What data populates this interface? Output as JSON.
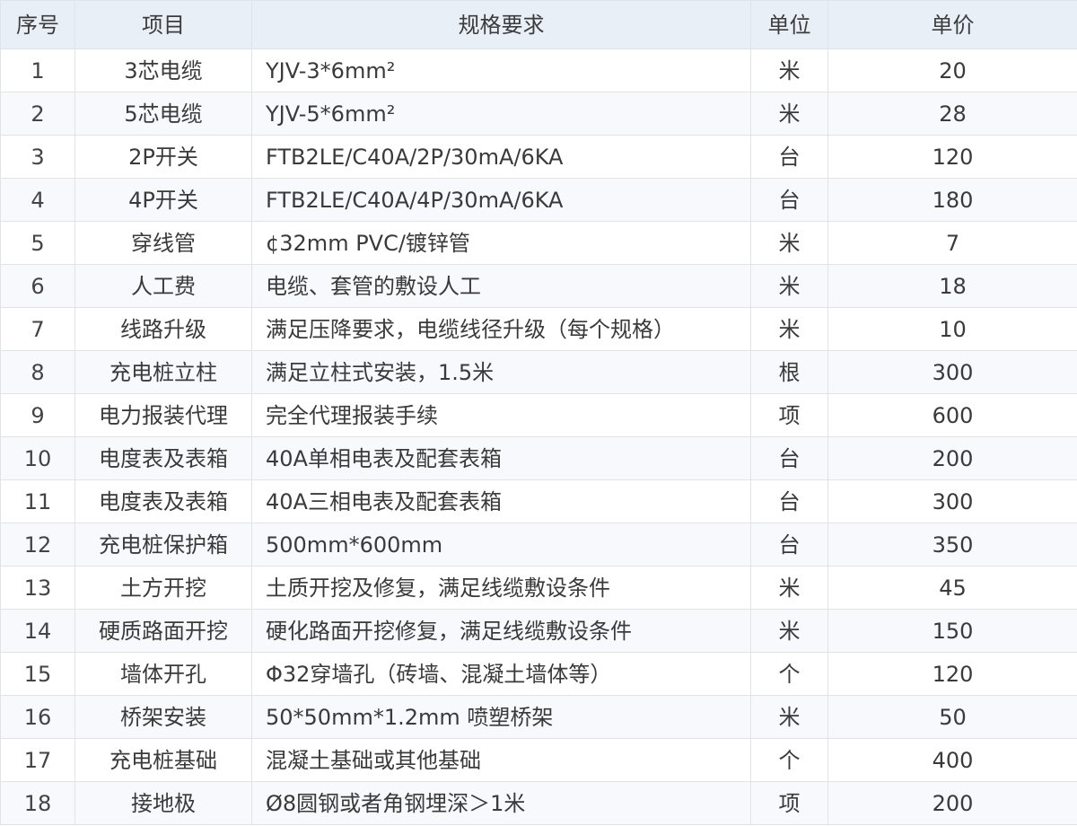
{
  "table": {
    "headers": [
      "序号",
      "项目",
      "规格要求",
      "单位",
      "单价"
    ],
    "rows": [
      {
        "index": "1",
        "item": "3芯电缆",
        "spec": "YJV-3*6mm²",
        "unit": "米",
        "price": "20"
      },
      {
        "index": "2",
        "item": "5芯电缆",
        "spec": "YJV-5*6mm²",
        "unit": "米",
        "price": "28"
      },
      {
        "index": "3",
        "item": "2P开关",
        "spec": "FTB2LE/C40A/2P/30mA/6KA",
        "unit": "台",
        "price": "120"
      },
      {
        "index": "4",
        "item": "4P开关",
        "spec": "FTB2LE/C40A/4P/30mA/6KA",
        "unit": "台",
        "price": "180"
      },
      {
        "index": "5",
        "item": "穿线管",
        "spec": "¢32mm PVC/镀锌管",
        "unit": "米",
        "price": "7"
      },
      {
        "index": "6",
        "item": "人工费",
        "spec": "电缆、套管的敷设人工",
        "unit": "米",
        "price": "18"
      },
      {
        "index": "7",
        "item": "线路升级",
        "spec": "满足压降要求，电缆线径升级（每个规格）",
        "unit": "米",
        "price": "10"
      },
      {
        "index": "8",
        "item": "充电桩立柱",
        "spec": "满足立柱式安装，1.5米",
        "unit": "根",
        "price": "300"
      },
      {
        "index": "9",
        "item": "电力报装代理",
        "spec": "完全代理报装手续",
        "unit": "项",
        "price": "600"
      },
      {
        "index": "10",
        "item": "电度表及表箱",
        "spec": "40A单相电表及配套表箱",
        "unit": "台",
        "price": "200"
      },
      {
        "index": "11",
        "item": "电度表及表箱",
        "spec": "40A三相电表及配套表箱",
        "unit": "台",
        "price": "300"
      },
      {
        "index": "12",
        "item": "充电桩保护箱",
        "spec": "500mm*600mm",
        "unit": "台",
        "price": "350"
      },
      {
        "index": "13",
        "item": "土方开挖",
        "spec": "土质开挖及修复，满足线缆敷设条件",
        "unit": "米",
        "price": "45"
      },
      {
        "index": "14",
        "item": "硬质路面开挖",
        "spec": "硬化路面开挖修复，满足线缆敷设条件",
        "unit": "米",
        "price": "150"
      },
      {
        "index": "15",
        "item": "墙体开孔",
        "spec": "Φ32穿墙孔（砖墙、混凝土墙体等）",
        "unit": "个",
        "price": "120"
      },
      {
        "index": "16",
        "item": "桥架安装",
        "spec": "50*50mm*1.2mm 喷塑桥架",
        "unit": "米",
        "price": "50"
      },
      {
        "index": "17",
        "item": "充电桩基础",
        "spec": "混凝土基础或其他基础",
        "unit": "个",
        "price": "400"
      },
      {
        "index": "18",
        "item": "接地极",
        "spec": "Ø8圆钢或者角钢埋深＞1米",
        "unit": "项",
        "price": "200"
      }
    ]
  },
  "colors": {
    "header_bg": "#e9eff6",
    "border": "#dfe4ea",
    "stripe_bg": "#f7f9fc",
    "text": "#3a3a3a"
  }
}
